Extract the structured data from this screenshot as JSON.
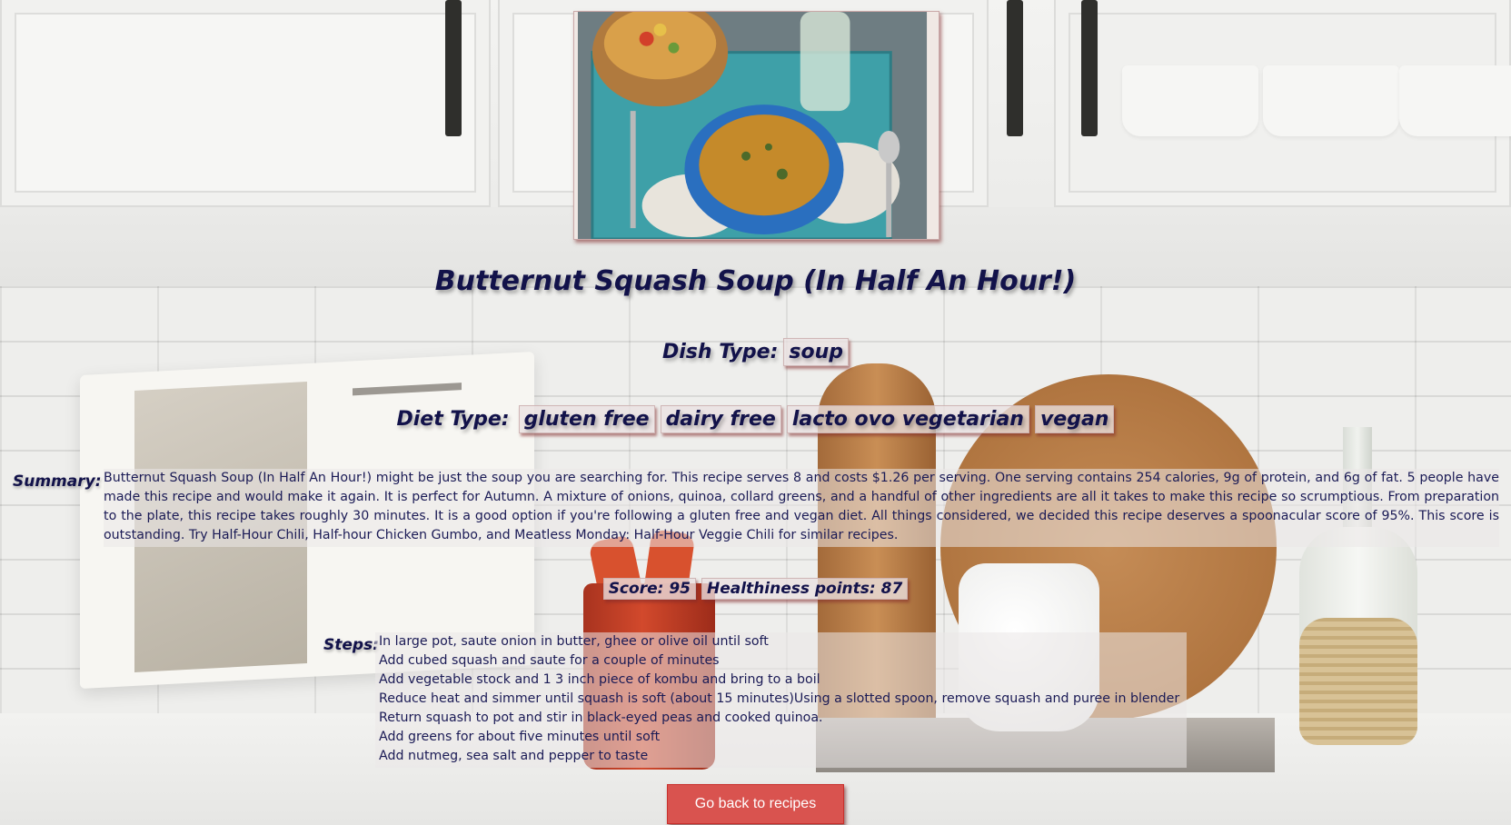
{
  "recipe": {
    "title": "Butternut Squash Soup (In Half An Hour!)",
    "dish_type_label": "Dish Type:",
    "dish_types": [
      "soup"
    ],
    "diet_type_label": "Diet Type:",
    "diet_types": [
      "gluten free",
      "dairy free",
      "lacto ovo vegetarian",
      "vegan"
    ],
    "summary_label": "Summary:",
    "summary": "Butternut Squash Soup (In Half An Hour!) might be just the soup you are searching for. This recipe serves 8 and costs $1.26 per serving. One serving contains 254 calories, 9g of protein, and 6g of fat. 5 people have made this recipe and would make it again. It is perfect for Autumn. A mixture of onions, quinoa, collard greens, and a handful of other ingredients are all it takes to make this recipe so scrumptious. From preparation to the plate, this recipe takes roughly 30 minutes. It is a good option if you're following a gluten free and vegan diet. All things considered, we decided this recipe deserves a spoonacular score of 95%. This score is outstanding. Try Half-Hour Chili, Half-hour Chicken Gumbo, and Meatless Monday: Half-Hour Veggie Chili for similar recipes.",
    "score_text": "Score: 95",
    "healthiness_text": "Healthiness points: 87",
    "steps_label": "Steps:",
    "steps": [
      "In large pot, saute onion in butter, ghee or olive oil until soft",
      "Add cubed squash and saute for a couple of minutes",
      "Add vegetable stock and 1 3 inch piece of kombu and bring to a boil",
      "Reduce heat and simmer until squash is soft (about 15 minutes)Using a slotted spoon, remove squash and puree in blender",
      "Return squash to pot and stir in black-eyed peas and cooked quinoa.",
      "Add greens for about five minutes until soft",
      "Add nutmeg, sea salt and pepper to taste"
    ]
  },
  "actions": {
    "back_label": "Go back to recipes"
  },
  "colors": {
    "text": "#12124a",
    "button": "#d9534f",
    "tag_shadow": "#822828"
  }
}
